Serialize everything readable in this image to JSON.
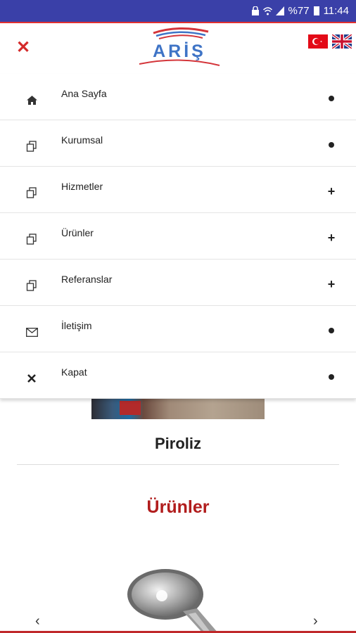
{
  "status_bar": {
    "battery_text": "%77",
    "time": "11:44"
  },
  "header": {
    "logo_text": "ARİŞ",
    "close_icon": "close-icon",
    "flags": [
      "turkish-flag",
      "uk-flag"
    ]
  },
  "menu": {
    "items": [
      {
        "label": "Ana Sayfa",
        "icon": "home-icon",
        "indicator": "dot"
      },
      {
        "label": "Kurumsal",
        "icon": "copy-icon",
        "indicator": "dot"
      },
      {
        "label": "Hizmetler",
        "icon": "copy-icon",
        "indicator": "plus"
      },
      {
        "label": "Ürünler",
        "icon": "copy-icon",
        "indicator": "plus"
      },
      {
        "label": "Referanslar",
        "icon": "copy-icon",
        "indicator": "plus"
      },
      {
        "label": "İletişim",
        "icon": "envelope-icon",
        "indicator": "dot"
      },
      {
        "label": "Kapat",
        "icon": "close-icon",
        "indicator": "dot"
      }
    ]
  },
  "content": {
    "section_title": "Piroliz",
    "products_heading": "Ürünler",
    "prev_arrow": "‹",
    "next_arrow": "›"
  },
  "colors": {
    "status_bar": "#3a40a8",
    "accent_red": "#d42a2a",
    "logo_blue": "#3f74c6",
    "heading_red": "#b11d1d"
  }
}
